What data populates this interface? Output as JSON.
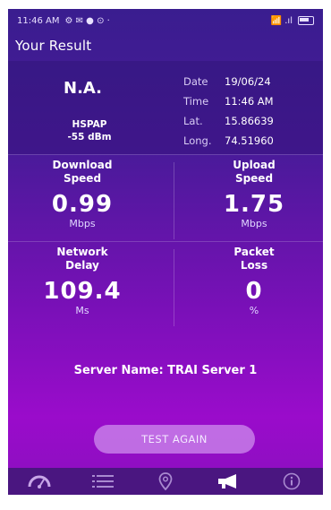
{
  "status_bar": {
    "time": "11:46 AM",
    "left_icons": "⚙ ✉ ● ⊙ ·",
    "signal": "📶 .ıl"
  },
  "header": {
    "title": "Your Result"
  },
  "info": {
    "operator": "N.A.",
    "network_type": "HSPAP",
    "signal_strength": "-55 dBm",
    "date_label": "Date",
    "date": "19/06/24",
    "time_label": "Time",
    "time": "11:46 AM",
    "lat_label": "Lat.",
    "lat": "15.86639",
    "long_label": "Long.",
    "long": "74.51960"
  },
  "metrics": {
    "download": {
      "title1": "Download",
      "title2": "Speed",
      "value": "0.99",
      "unit": "Mbps"
    },
    "upload": {
      "title1": "Upload",
      "title2": "Speed",
      "value": "1.75",
      "unit": "Mbps"
    },
    "delay": {
      "title1": "Network",
      "title2": "Delay",
      "value": "109.4",
      "unit": "Ms"
    },
    "loss": {
      "title1": "Packet",
      "title2": "Loss",
      "value": "0",
      "unit": "%"
    }
  },
  "server": {
    "text": "Server Name: TRAI Server 1"
  },
  "button": {
    "label": "TEST AGAIN"
  },
  "nav": {
    "items": [
      "speedometer-icon",
      "list-icon",
      "location-pin-icon",
      "megaphone-icon",
      "info-icon"
    ]
  }
}
